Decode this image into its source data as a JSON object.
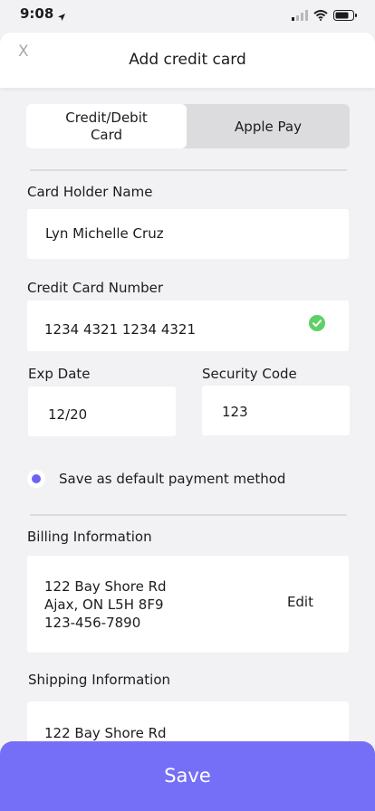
{
  "status_bar": {
    "time": "9:08"
  },
  "header": {
    "close_label": "X",
    "title": "Add credit card"
  },
  "payment_tabs": {
    "card_line1": "Credit/Debit",
    "card_line2": "Card",
    "apple_pay": "Apple Pay"
  },
  "card_holder": {
    "label": "Card Holder Name",
    "value": "Lyn Michelle Cruz"
  },
  "card_number": {
    "label": "Credit Card Number",
    "value": "1234 4321 1234 4321"
  },
  "exp_date": {
    "label": "Exp Date",
    "value": "12/20"
  },
  "security_code": {
    "label": "Security Code",
    "value": "123"
  },
  "default_payment": {
    "label": "Save as default payment method"
  },
  "billing": {
    "label": "Billing Information",
    "line1": "122 Bay Shore Rd",
    "line2": "Ajax, ON L5H 8F9",
    "line3": "123-456-7890",
    "edit_label": "Edit"
  },
  "shipping": {
    "label": "Shipping Information",
    "line1": "122 Bay Shore Rd"
  },
  "footer": {
    "save_label": "Save"
  },
  "colors": {
    "accent": "#756ff7",
    "radio": "#6c63f5",
    "check": "#5fd068"
  }
}
